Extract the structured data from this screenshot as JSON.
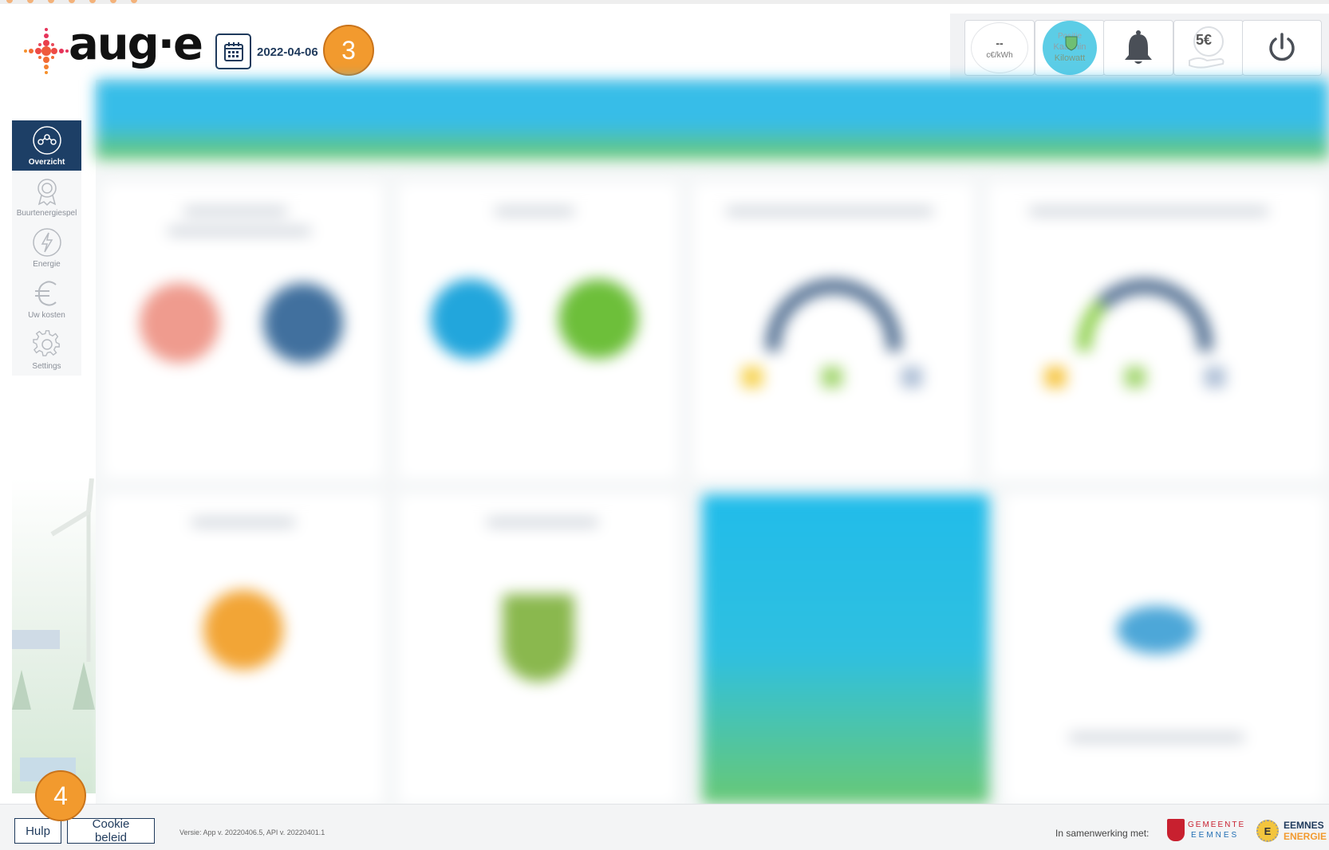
{
  "header": {
    "brand": "aug·e",
    "date": "2022-04-06",
    "price": {
      "value": "--",
      "unit": "c€/kWh"
    },
    "position": {
      "line1": "Positie",
      "line2": "Kaa-thin",
      "line3": "Kilowatt"
    },
    "cost_badge": "5€"
  },
  "markers": {
    "date_marker": "3",
    "help_marker": "4"
  },
  "sidebar": {
    "items": [
      {
        "label": "Overzicht",
        "active": true
      },
      {
        "label": "Buurtenergiespel",
        "active": false
      },
      {
        "label": "Energie",
        "active": false
      },
      {
        "label": "Uw kosten",
        "active": false
      },
      {
        "label": "Settings",
        "active": false
      }
    ]
  },
  "footer": {
    "help_label": "Hulp",
    "cookie_label": "Cookie beleid",
    "version": "Versie: App v. 20220406.5, API v. 20220401.1",
    "collab_label": "In samenwerking met:",
    "gemeente_line1": "GEMEENTE",
    "gemeente_line2": "EEMNES",
    "eemnes_line1": "EEMNES",
    "eemnes_line2": "ENERGIE",
    "eemnes_mark": "E"
  },
  "colors": {
    "navy": "#1d3f66",
    "accent_orange": "#f29a2e",
    "banner_blue": "#37bde8",
    "banner_green": "#6cc96e"
  },
  "icons": {
    "calendar": "calendar-icon",
    "bell": "bell-icon",
    "power": "power-icon",
    "euro_hand": "euro-hand-icon",
    "overview": "overview-icon",
    "medal": "medal-icon",
    "lightning": "lightning-icon",
    "euro": "euro-icon",
    "gear": "gear-icon"
  }
}
